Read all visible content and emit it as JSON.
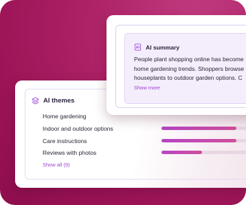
{
  "themes": {
    "title": "AI themes",
    "items": [
      {
        "label": "Home gardening",
        "fill": null
      },
      {
        "label": "Indoor and outdoor options",
        "fill": 0.78
      },
      {
        "label": "Care instructions",
        "fill": 0.78
      },
      {
        "label": "Reviews with photos",
        "fill": 0.42
      }
    ],
    "show_all_label": "Show all (9)"
  },
  "summary": {
    "title": "AI summary",
    "lines": [
      "People plant shopping online has become",
      "home gardening trends. Shoppers browse",
      "houseplants to outdoor garden options. C"
    ],
    "show_more_label": "Show more"
  },
  "colors": {
    "background": "#a8195f",
    "accent": "#9a3fd0",
    "bar": "#c04aab"
  }
}
